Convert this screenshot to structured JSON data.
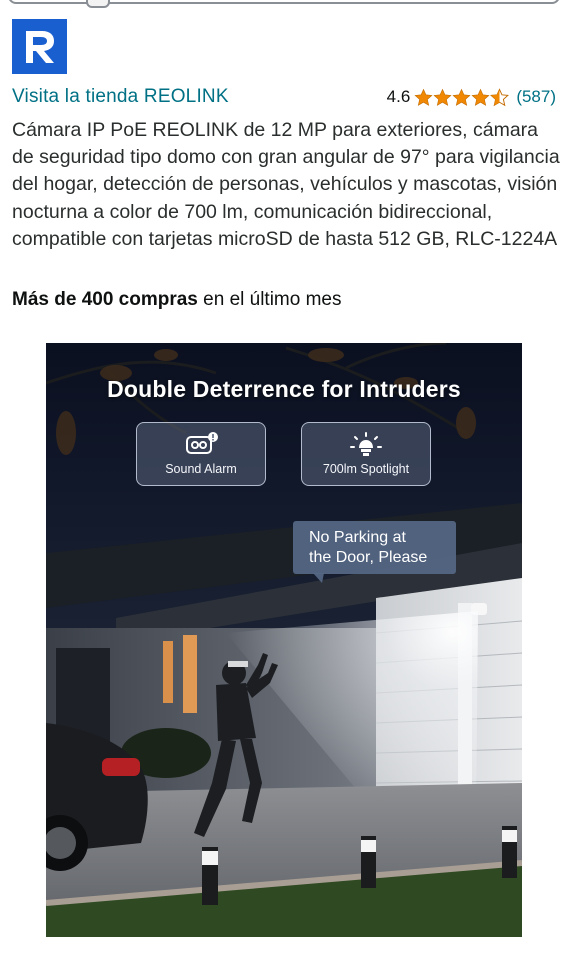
{
  "store": {
    "brand_logo_letter": "R",
    "brand_color": "#1a5fd0",
    "visit_link": "Visita la tienda REOLINK"
  },
  "rating": {
    "value": "4.6",
    "stars_filled": 4.5,
    "star_color": "#f08804",
    "count": "(587)"
  },
  "product": {
    "title": "Cámara IP PoE REOLINK de 12 MP para exteriores, cámara de seguridad tipo domo con gran angular de 97° para vigilancia del hogar, detección de personas, vehículos y mascotas, visión nocturna a color de 700 lm, comunicación bidireccional, compatible con tarjetas microSD de hasta 512 GB, RLC-1224A"
  },
  "purchases": {
    "bold": "Más de 400 compras",
    "rest": " en el último mes"
  },
  "hero_image": {
    "headline": "Double Deterrence for Intruders",
    "features": [
      {
        "icon": "siren-icon",
        "label": "Sound Alarm"
      },
      {
        "icon": "spotlight-icon",
        "label": "700lm Spotlight"
      }
    ],
    "speech_line1": "No Parking at",
    "speech_line2": "the Door, Please"
  }
}
